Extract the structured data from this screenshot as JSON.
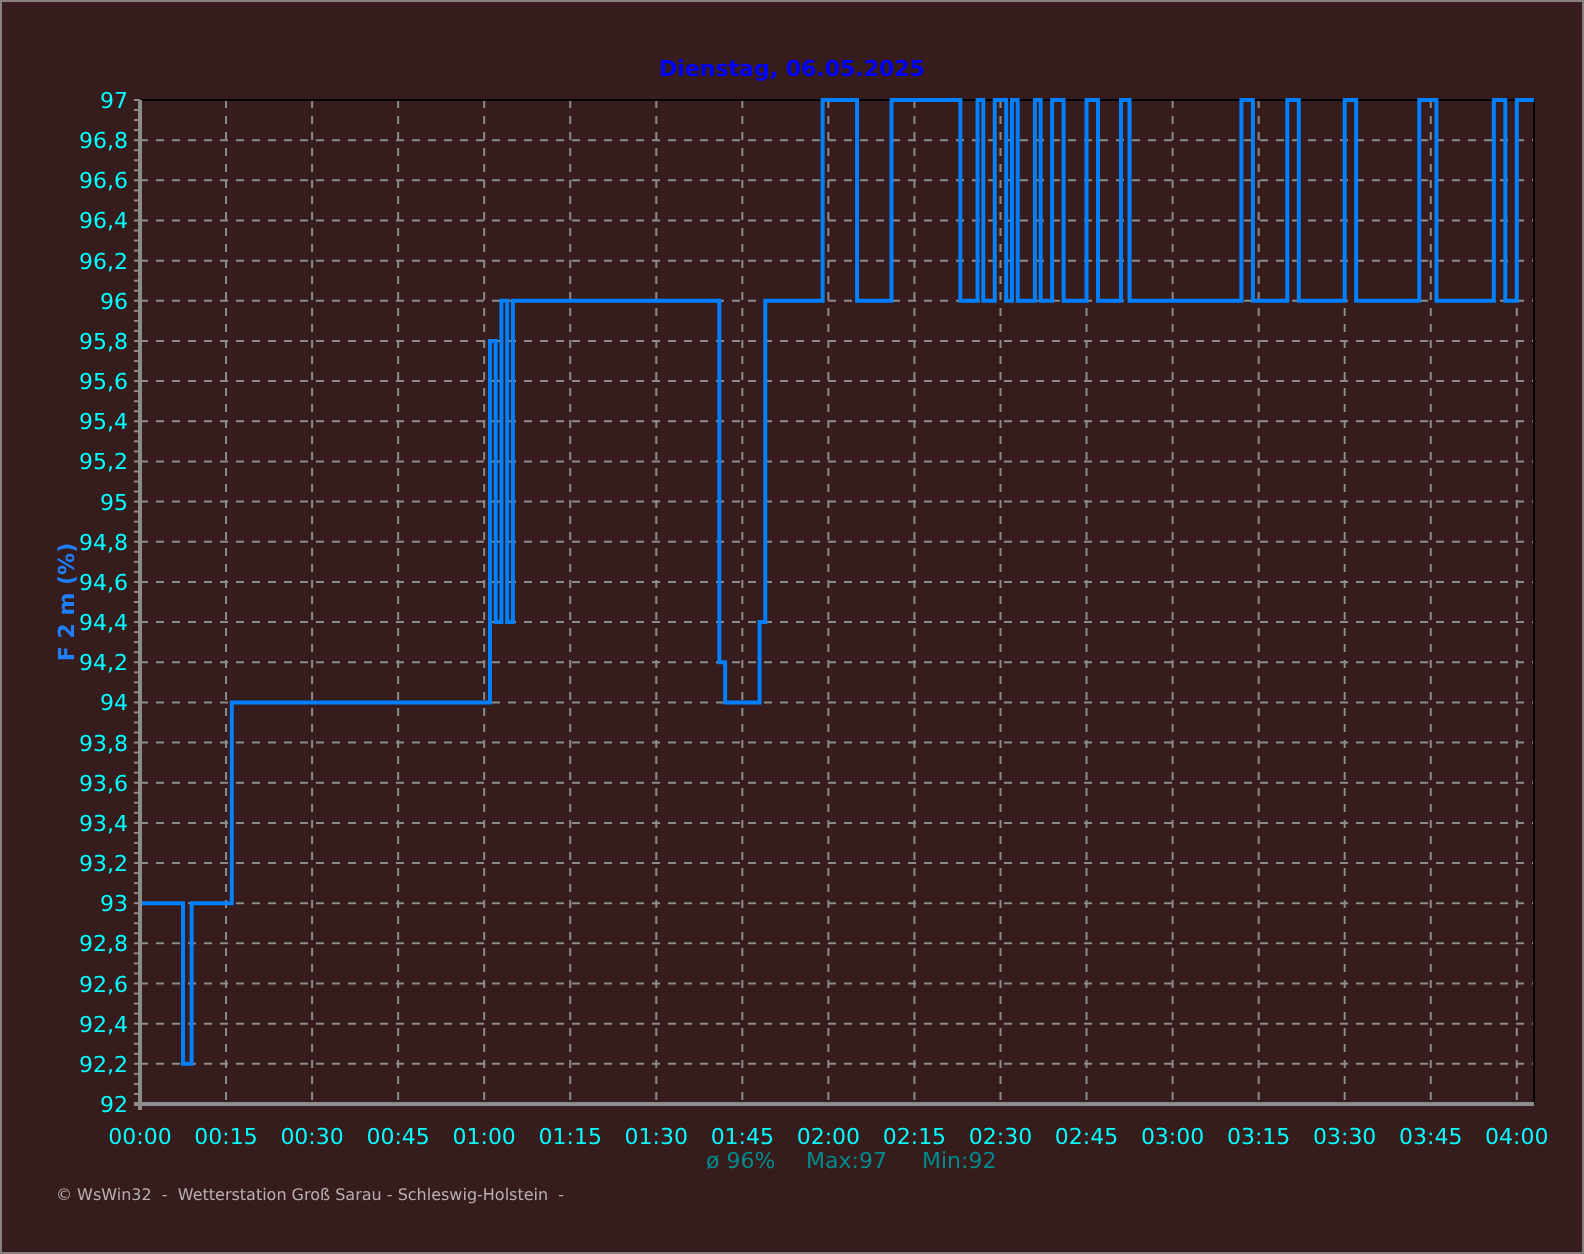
{
  "chart_data": {
    "type": "line",
    "title": "Dienstag, 06.05.2025",
    "xlabel": null,
    "ylabel": "F 2 m (%)",
    "x": [
      0,
      7.5,
      7.5,
      9,
      9,
      16,
      16,
      61,
      61,
      62,
      62,
      63,
      63,
      64,
      64,
      65,
      65,
      101,
      101,
      102,
      102,
      108,
      108,
      109,
      109,
      119,
      119,
      125,
      125,
      131,
      131,
      143,
      143,
      146,
      146,
      147,
      147,
      149,
      149,
      151,
      151,
      152,
      152,
      153,
      153,
      156,
      156,
      157,
      157,
      159,
      159,
      161,
      161,
      165,
      165,
      167,
      167,
      171,
      171,
      172.5,
      172.5,
      192,
      192,
      194,
      194,
      200,
      200,
      202,
      202,
      210,
      210,
      212,
      212,
      223,
      223,
      226,
      226,
      236,
      236,
      238,
      238,
      240,
      240,
      243
    ],
    "series": [
      {
        "color": "#0080ff",
        "values": [
          93,
          93,
          92.2,
          92.2,
          93,
          93,
          94,
          94,
          95.8,
          95.8,
          94.4,
          94.4,
          96,
          96,
          94.4,
          94.4,
          96,
          96,
          94.2,
          94.2,
          94,
          94,
          94.4,
          94.4,
          96,
          96,
          97,
          97,
          96,
          96,
          97,
          97,
          96,
          96,
          97,
          97,
          96,
          96,
          97,
          97,
          96,
          96,
          97,
          97,
          96,
          96,
          97,
          97,
          96,
          96,
          97,
          97,
          96,
          96,
          97,
          97,
          96,
          96,
          97,
          97,
          96,
          96,
          97,
          97,
          96,
          96,
          97,
          97,
          96,
          96,
          97,
          97,
          96,
          96,
          97,
          97,
          96,
          96,
          97,
          97,
          96,
          96,
          97,
          97
        ]
      }
    ],
    "grid": true,
    "xlim": [
      0,
      243
    ],
    "ylim": [
      92,
      97
    ],
    "xticks": [
      {
        "value": 0,
        "label": "00:00"
      },
      {
        "value": 15,
        "label": "00:15"
      },
      {
        "value": 30,
        "label": "00:30"
      },
      {
        "value": 45,
        "label": "00:45"
      },
      {
        "value": 60,
        "label": "01:00"
      },
      {
        "value": 75,
        "label": "01:15"
      },
      {
        "value": 90,
        "label": "01:30"
      },
      {
        "value": 105,
        "label": "01:45"
      },
      {
        "value": 120,
        "label": "02:00"
      },
      {
        "value": 135,
        "label": "02:15"
      },
      {
        "value": 150,
        "label": "02:30"
      },
      {
        "value": 165,
        "label": "02:45"
      },
      {
        "value": 180,
        "label": "03:00"
      },
      {
        "value": 195,
        "label": "03:15"
      },
      {
        "value": 210,
        "label": "03:30"
      },
      {
        "value": 225,
        "label": "03:45"
      },
      {
        "value": 240,
        "label": "04:00"
      }
    ],
    "yticks": [
      {
        "value": 92,
        "label": "92"
      },
      {
        "value": 92.2,
        "label": "92,2"
      },
      {
        "value": 92.4,
        "label": "92,4"
      },
      {
        "value": 92.6,
        "label": "92,6"
      },
      {
        "value": 92.8,
        "label": "92,8"
      },
      {
        "value": 93,
        "label": "93"
      },
      {
        "value": 93.2,
        "label": "93,2"
      },
      {
        "value": 93.4,
        "label": "93,4"
      },
      {
        "value": 93.6,
        "label": "93,6"
      },
      {
        "value": 93.8,
        "label": "93,8"
      },
      {
        "value": 94,
        "label": "94"
      },
      {
        "value": 94.2,
        "label": "94,2"
      },
      {
        "value": 94.4,
        "label": "94,4"
      },
      {
        "value": 94.6,
        "label": "94,6"
      },
      {
        "value": 94.8,
        "label": "94,8"
      },
      {
        "value": 95,
        "label": "95"
      },
      {
        "value": 95.2,
        "label": "95,2"
      },
      {
        "value": 95.4,
        "label": "95,4"
      },
      {
        "value": 95.6,
        "label": "95,6"
      },
      {
        "value": 95.8,
        "label": "95,8"
      },
      {
        "value": 96,
        "label": "96"
      },
      {
        "value": 96.2,
        "label": "96,2"
      },
      {
        "value": 96.4,
        "label": "96,4"
      },
      {
        "value": 96.6,
        "label": "96,6"
      },
      {
        "value": 96.8,
        "label": "96,8"
      },
      {
        "value": 97,
        "label": "97"
      }
    ]
  },
  "summary": {
    "mean": "ø 96%",
    "max": "Max:97",
    "min": "Min:92"
  },
  "footer": "© WsWin32  -  Wetterstation Groß Sarau - Schleswig-Holstein  -"
}
